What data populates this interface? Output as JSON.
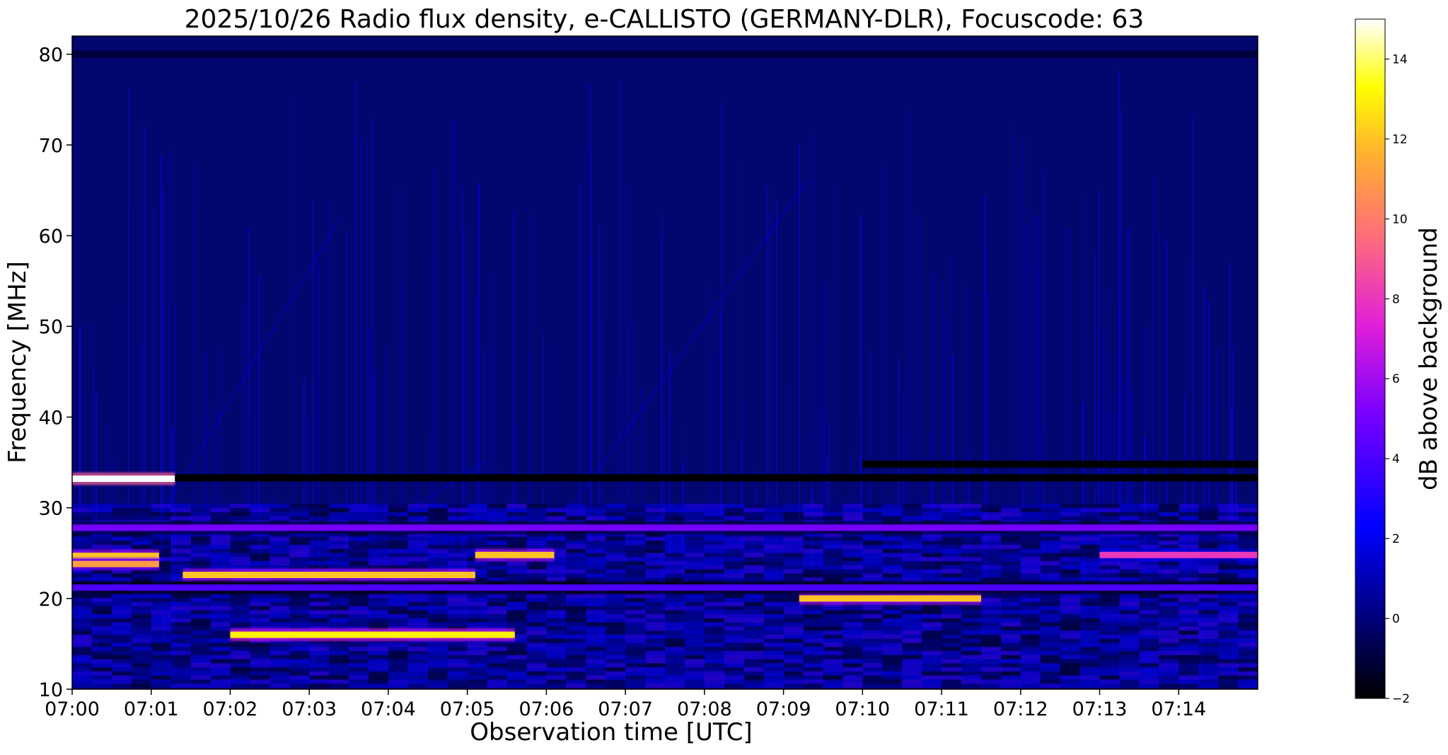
{
  "chart_data": {
    "type": "heatmap",
    "title": "2025/10/26  Radio flux density, e-CALLISTO (GERMANY-DLR), Focuscode: 63",
    "xlabel": "Observation time [UTC]",
    "ylabel": "Frequency [MHz]",
    "x_ticks": [
      "07:00",
      "07:01",
      "07:02",
      "07:03",
      "07:04",
      "07:05",
      "07:06",
      "07:07",
      "07:08",
      "07:09",
      "07:10",
      "07:11",
      "07:12",
      "07:13",
      "07:14"
    ],
    "x_range": [
      "07:00",
      "07:15"
    ],
    "y_ticks": [
      10,
      20,
      30,
      40,
      50,
      60,
      70,
      80
    ],
    "ylim": [
      10,
      82
    ],
    "colorbar": {
      "label": "dB above background",
      "ticks": [
        -2,
        0,
        2,
        4,
        6,
        8,
        10,
        12,
        14
      ],
      "range": [
        -2,
        15
      ],
      "colormap": "gnuplot2",
      "colors": [
        "#000000",
        "#0000ff",
        "#8000ff",
        "#ff33cc",
        "#ff9933",
        "#ffff00",
        "#ffffff"
      ]
    },
    "background_level_db": 0,
    "features": [
      {
        "kind": "narrowband-interference",
        "t_start_min": 0.0,
        "t_end_min": 1.3,
        "freq_mhz": 33.2,
        "level_db": 15
      },
      {
        "kind": "narrowband-interference",
        "t_start_min": 0.0,
        "t_end_min": 1.1,
        "freq_mhz": 24.7,
        "level_db": 12
      },
      {
        "kind": "narrowband-interference",
        "t_start_min": 0.0,
        "t_end_min": 1.1,
        "freq_mhz": 23.8,
        "level_db": 11
      },
      {
        "kind": "narrowband-interference",
        "t_start_min": 1.4,
        "t_end_min": 5.1,
        "freq_mhz": 22.6,
        "level_db": 12
      },
      {
        "kind": "narrowband-interference",
        "t_start_min": 5.1,
        "t_end_min": 6.1,
        "freq_mhz": 24.8,
        "level_db": 12
      },
      {
        "kind": "narrowband-interference",
        "t_start_min": 2.0,
        "t_end_min": 5.6,
        "freq_mhz": 16.0,
        "level_db": 13
      },
      {
        "kind": "narrowband-interference",
        "t_start_min": 9.2,
        "t_end_min": 11.5,
        "freq_mhz": 20.0,
        "level_db": 12
      },
      {
        "kind": "narrowband-interference",
        "t_start_min": 13.0,
        "t_end_min": 15.0,
        "freq_mhz": 24.8,
        "level_db": 8
      },
      {
        "kind": "narrowband-interference",
        "t_start_min": 0.0,
        "t_end_min": 15.0,
        "freq_mhz": 27.8,
        "level_db": 5
      },
      {
        "kind": "narrowband-interference",
        "t_start_min": 0.0,
        "t_end_min": 15.0,
        "freq_mhz": 21.2,
        "level_db": 4
      },
      {
        "kind": "dead-band",
        "t_start_min": 1.3,
        "t_end_min": 15.0,
        "freq_mhz": 33.3,
        "level_db": -2
      },
      {
        "kind": "dead-band",
        "t_start_min": 10.0,
        "t_end_min": 15.0,
        "freq_mhz": 34.8,
        "level_db": -2
      },
      {
        "kind": "dead-band",
        "t_start_min": 0.0,
        "t_end_min": 15.0,
        "freq_mhz": 80.0,
        "level_db": -1
      }
    ]
  }
}
